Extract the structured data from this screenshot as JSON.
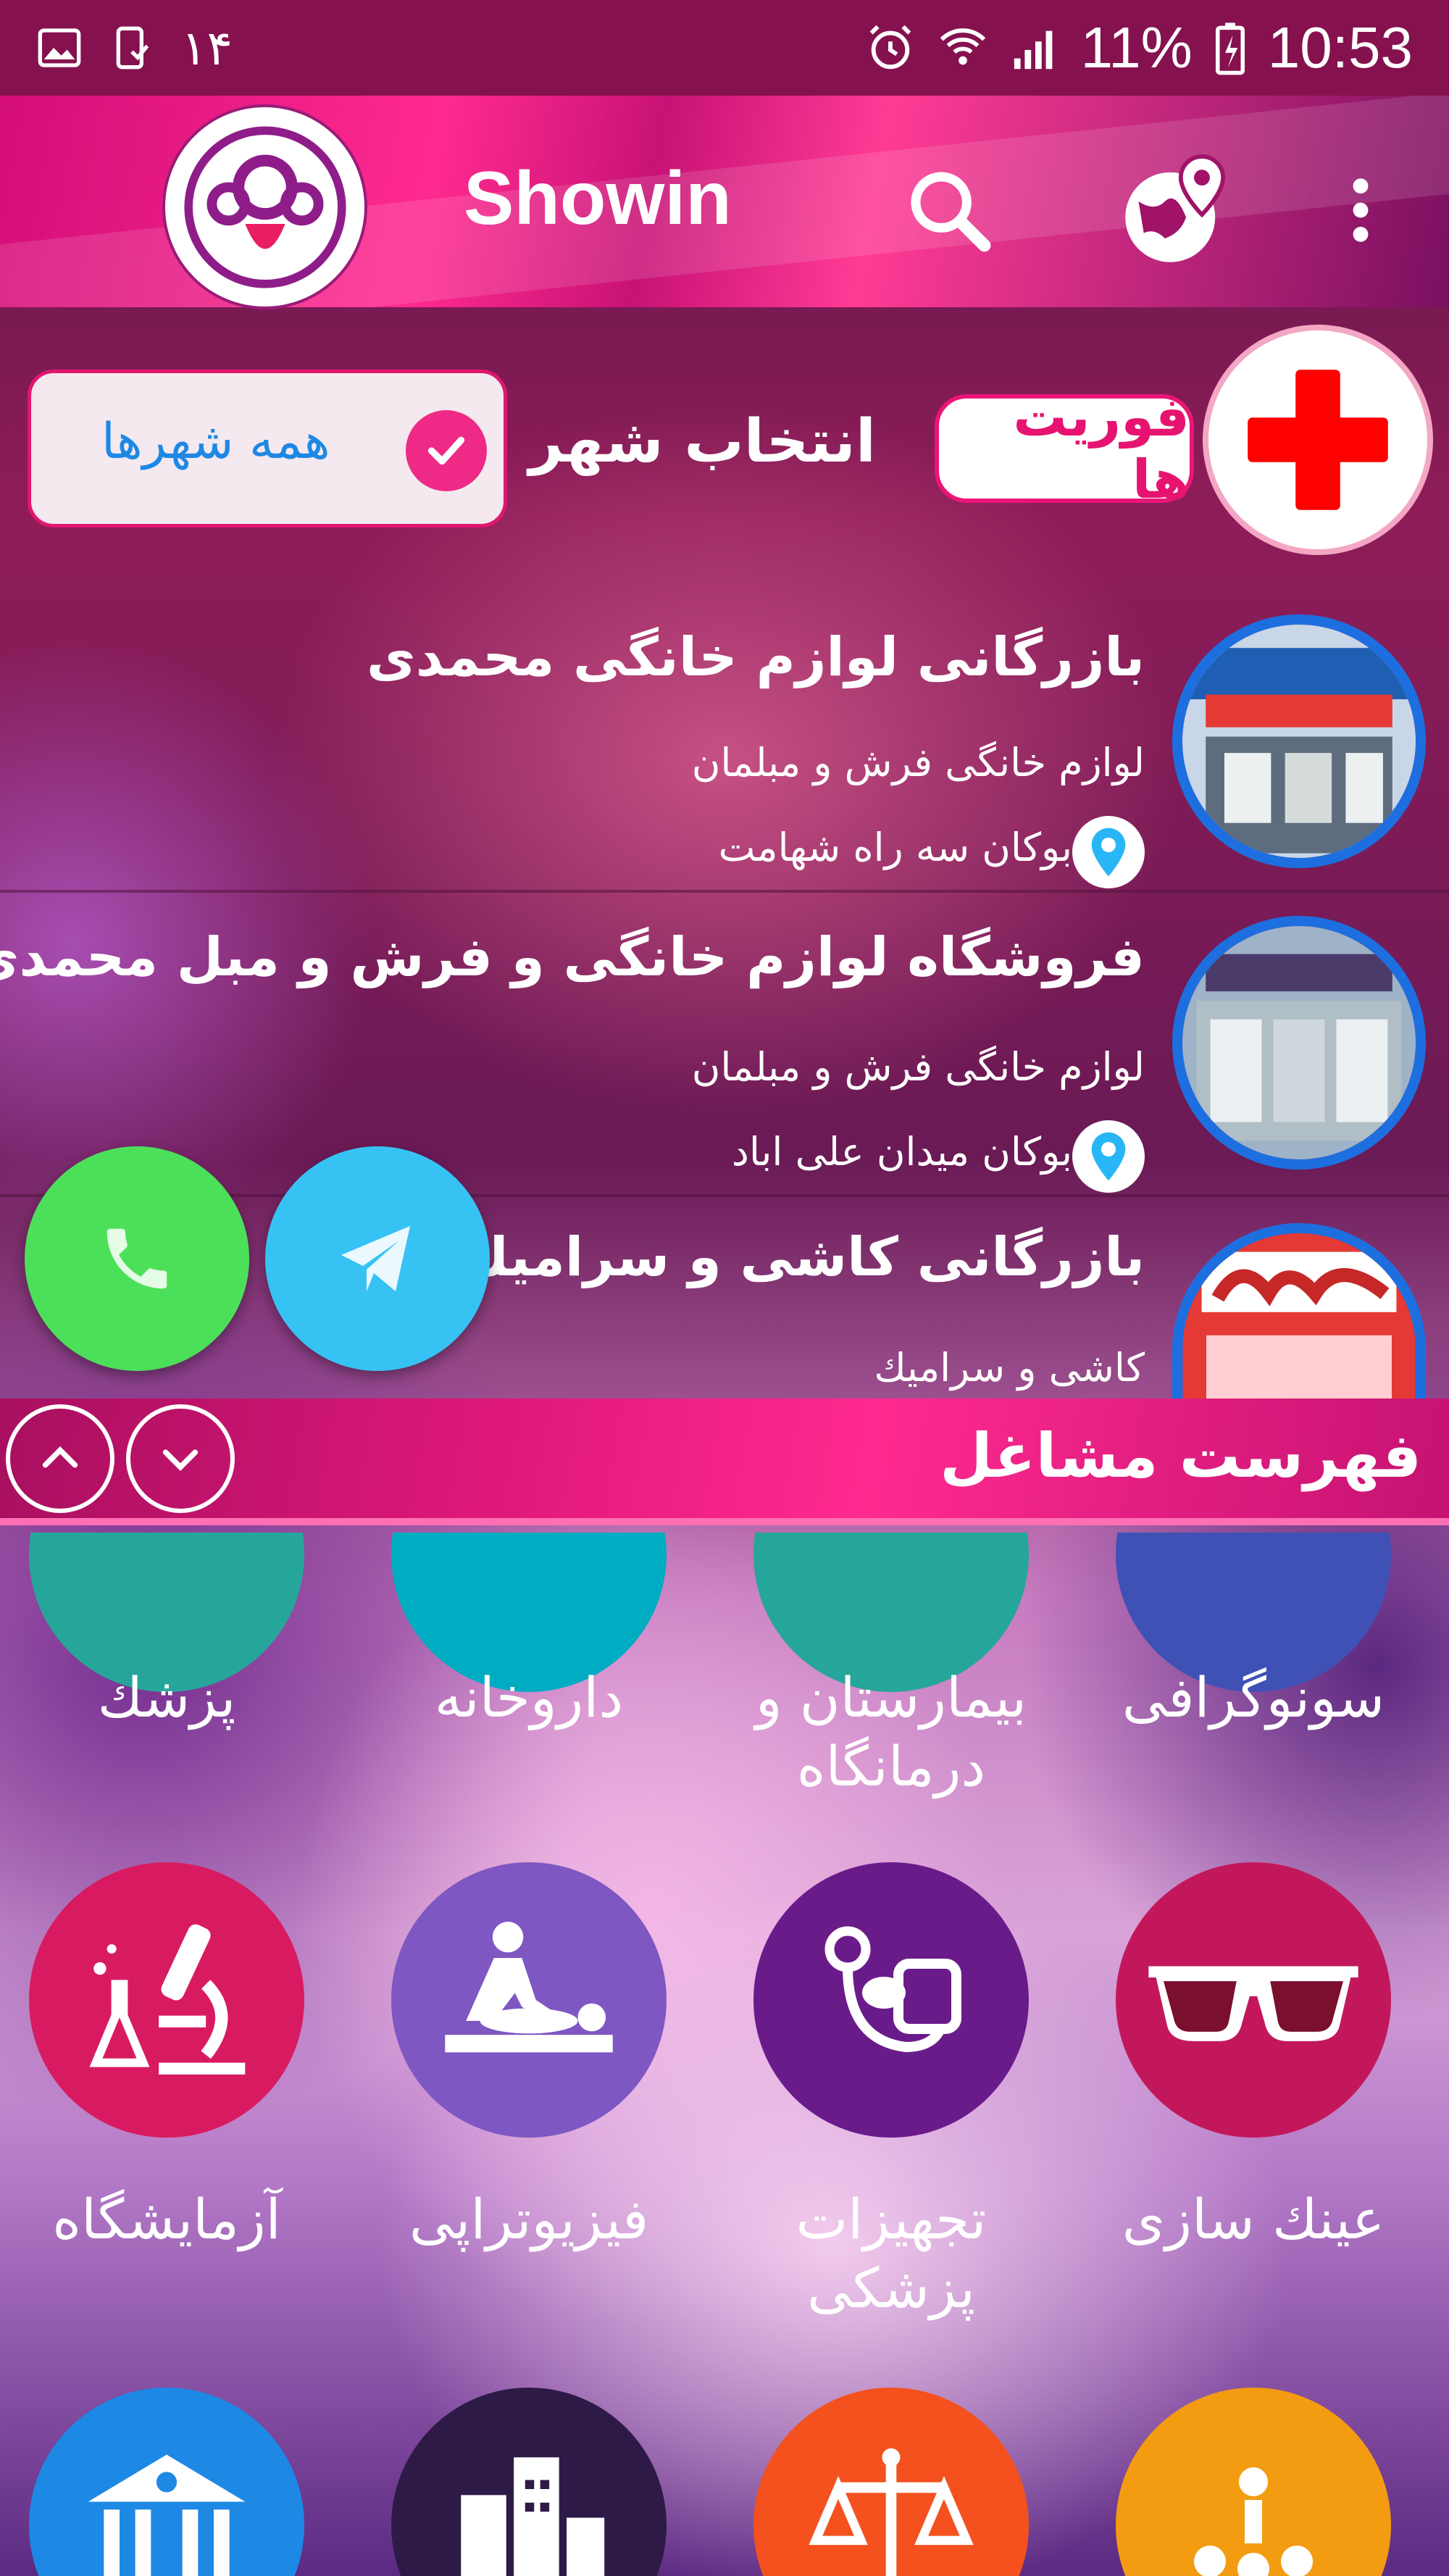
{
  "status_bar": {
    "left_number": "۱۴",
    "battery": "11%",
    "time": "10:53",
    "icons": [
      "gallery-icon",
      "download-done-icon",
      "alarm-icon",
      "wifi-icon",
      "signal-icon",
      "battery-charging-icon"
    ]
  },
  "app_bar": {
    "title": "Showin",
    "icons": [
      "app-logo-icon",
      "search-icon",
      "globe-location-icon",
      "overflow-menu-icon"
    ]
  },
  "city_selector": {
    "selected_city": "همه شهرها",
    "label": "انتخاب شهر"
  },
  "favorites": {
    "label": "فوریت ها"
  },
  "listings": [
    {
      "title": "بازرگانی لوازم خانگی محمدی",
      "category": "لوازم خانگی فرش و مبلمان",
      "address": "بوکان سه راه شهامت"
    },
    {
      "title": "فروشگاه لوازم خانگی و فرش و مبل محمدی",
      "category": "لوازم خانگی فرش و مبلمان",
      "address": "بوکان میدان علی اباد"
    },
    {
      "title": "بازرگانی کاشی و سرامیك صا",
      "category": "کاشی و سرامیك",
      "address": ""
    }
  ],
  "section": {
    "title": "فهرست مشاغل"
  },
  "categories_row1": [
    {
      "label": "سونوگرافی",
      "color": "#3f51b5"
    },
    {
      "label": "بیمارستان و درمانگاه",
      "color": "#26a69a"
    },
    {
      "label": "داروخانه",
      "color": "#00acc1"
    },
    {
      "label": "پزشك",
      "color": "#26a69a"
    }
  ],
  "categories_row2": [
    {
      "label": "عینك سازی",
      "color": "#c2185b",
      "icon": "glasses-icon"
    },
    {
      "label": "تجهیزات پزشکی",
      "color": "#6a1b8a",
      "icon": "blood-pressure-icon"
    },
    {
      "label": "فیزیوتراپی",
      "color": "#7e57c2",
      "icon": "massage-icon"
    },
    {
      "label": "آزمایشگاه",
      "color": "#d81b60",
      "icon": "microscope-icon"
    }
  ],
  "categories_row3": [
    {
      "color": "#f39c12",
      "icon": "people-icon"
    },
    {
      "color": "#f4511e",
      "icon": "scales-icon"
    },
    {
      "color": "#2e1a47",
      "icon": "buildings-icon"
    },
    {
      "color": "#1e88e5",
      "icon": "bank-icon"
    }
  ]
}
